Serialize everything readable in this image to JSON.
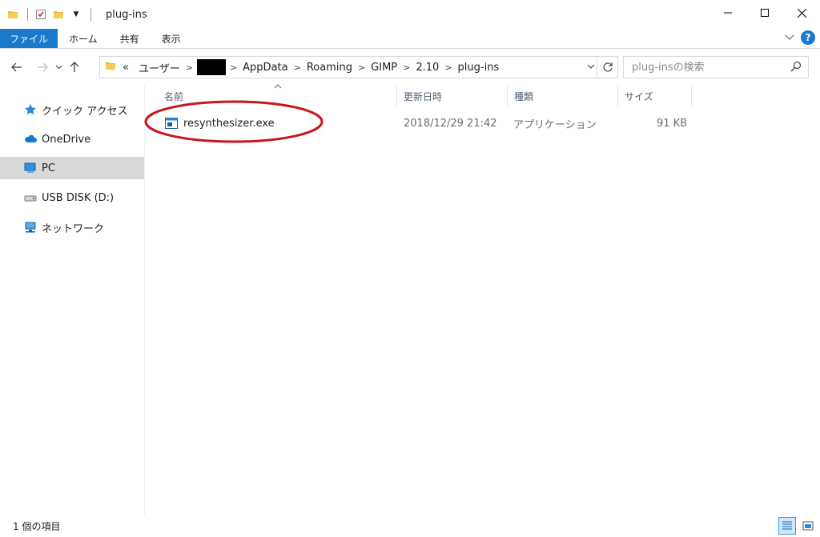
{
  "window": {
    "title": "plug-ins",
    "controls": [
      "minimize",
      "maximize",
      "close"
    ]
  },
  "ribbon": {
    "tabs": [
      {
        "label": "ファイル",
        "active": true
      },
      {
        "label": "ホーム"
      },
      {
        "label": "共有"
      },
      {
        "label": "表示"
      }
    ]
  },
  "address": {
    "overflow": "«",
    "crumbs": [
      "ユーザー",
      "AppData",
      "Roaming",
      "GIMP",
      "2.10",
      "plug-ins"
    ],
    "redacted_after_index": 0
  },
  "search": {
    "placeholder": "plug-insの検索"
  },
  "sidebar": {
    "items": [
      {
        "label": "クイック アクセス",
        "icon": "star-icon"
      },
      {
        "label": "OneDrive",
        "icon": "cloud-icon"
      },
      {
        "label": "PC",
        "icon": "computer-icon",
        "selected": true
      },
      {
        "label": "USB DISK (D:)",
        "icon": "usb-drive-icon"
      },
      {
        "label": "ネットワーク",
        "icon": "network-icon"
      }
    ]
  },
  "columns": {
    "name": "名前",
    "date": "更新日時",
    "type": "種類",
    "size": "サイズ"
  },
  "files": [
    {
      "name": "resynthesizer.exe",
      "date": "2018/12/29 21:42",
      "type": "アプリケーション",
      "size": "91 KB",
      "highlighted": true
    }
  ],
  "status": {
    "count": "1 個の項目"
  },
  "colors": {
    "accent": "#1979ca",
    "highlight_circle": "#c8161d",
    "selected_nav": "#d9d9d9"
  }
}
